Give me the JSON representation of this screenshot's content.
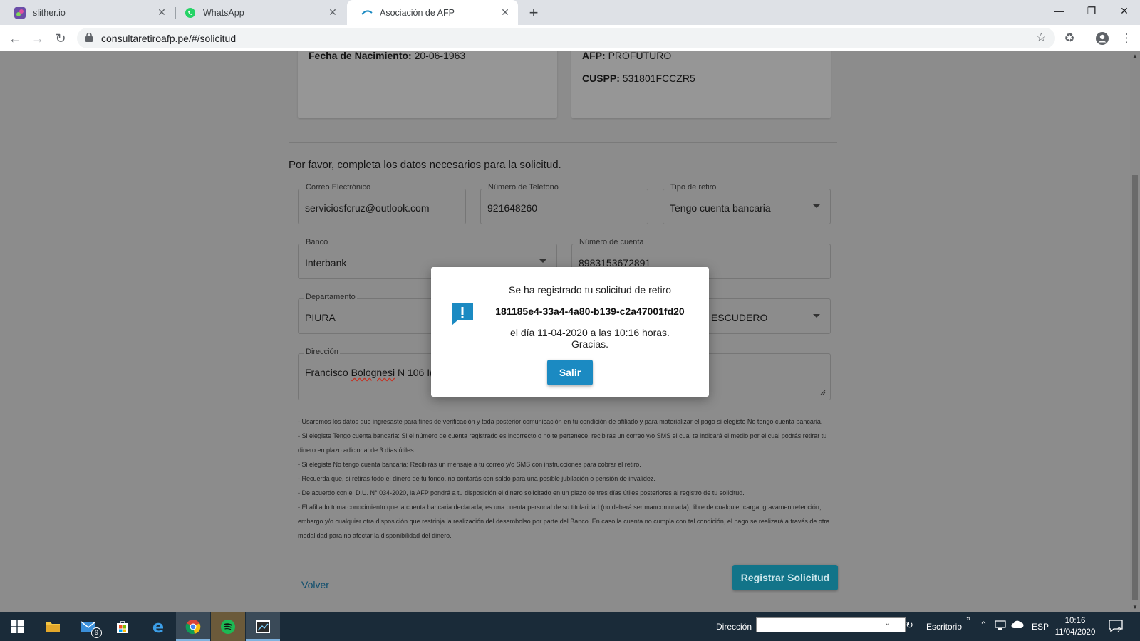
{
  "browser": {
    "tabs": [
      {
        "title": "slither.io",
        "close": "✕"
      },
      {
        "title": "WhatsApp",
        "close": "✕"
      },
      {
        "title": "Asociación de AFP",
        "close": "✕",
        "active": true
      }
    ],
    "new_tab": "+",
    "window_controls": {
      "minimize": "—",
      "restore": "❐",
      "close": "✕"
    },
    "url": "consultaretiroafp.pe/#/solicitud"
  },
  "page": {
    "personal": {
      "fecha_label": "Fecha de Nacimiento:",
      "fecha_value": "20-06-1963",
      "afp_label": "AFP:",
      "afp_value": "PROFUTURO",
      "cuspp_label": "CUSPP:",
      "cuspp_value": "531801FCCZR5"
    },
    "prompt": "Por favor, completa los datos necesarios para la solicitud.",
    "fields": {
      "email": {
        "label": "Correo Electrónico",
        "value": "serviciosfcruz@outlook.com"
      },
      "phone": {
        "label": "Número de Teléfono",
        "value": "921648260"
      },
      "withdrawal_type": {
        "label": "Tipo de retiro",
        "value": "Tengo cuenta bancaria"
      },
      "bank": {
        "label": "Banco",
        "value": "Interbank"
      },
      "account": {
        "label": "Número de cuenta",
        "value": "8983153672891"
      },
      "department": {
        "label": "Departamento",
        "value": "PIURA"
      },
      "district": {
        "value": "ESCUDERO"
      },
      "address": {
        "label": "Dirección",
        "value_a": "Francisco ",
        "value_b": "Bolognesi",
        "value_c": " N 106 I("
      }
    },
    "notes": [
      "- Usaremos los datos que ingresaste para fines de verificación y toda posterior comunicación en tu condición de afiliado y para materializar el pago si elegiste No tengo cuenta bancaria.",
      "- Si elegiste Tengo cuenta bancaria: Si el número de cuenta registrado es incorrecto o no te pertenece, recibirás un correo y/o SMS el cual te indicará el medio por el cual podrás retirar tu dinero en plazo adicional de 3 días útiles.",
      "- Si elegiste No tengo cuenta bancaria: Recibirás un mensaje a tu correo y/o SMS con instrucciones para cobrar el retiro.",
      "- Recuerda que, si retiras todo el dinero de tu fondo, no contarás con saldo para una posible jubilación o pensión de invalidez.",
      "- De acuerdo con el D.U. N° 034-2020, la AFP pondrá a tu disposición el dinero solicitado en un plazo de tres días útiles posteriores al registro de tu solicitud.",
      "- El afiliado toma conocimiento que la cuenta bancaria declarada, es una cuenta personal de su titularidad (no deberá ser mancomunada), libre de cualquier carga, gravamen retención, embargo y/o cualquier otra disposición que restrinja la realización del desembolso por parte del Banco. En caso la cuenta no cumpla con tal condición, el pago se realizará a través de otra modalidad para no afectar la disponibilidad del dinero."
    ],
    "back_label": "Volver",
    "submit_label": "Registrar Solicitud"
  },
  "modal": {
    "line1": "Se ha registrado tu solicitud de retiro",
    "request_id": "181185e4-33a4-4a80-b139-c2a47001fd20",
    "line3": "el día 11-04-2020 a las 10:16 horas. Gracias.",
    "exit_label": "Salir",
    "accent": "#1b8ac2"
  },
  "taskbar": {
    "mail_badge": "9",
    "address_label": "Dirección",
    "desktop_label": "Escritorio",
    "chevrons": "»",
    "language": "ESP",
    "time": "10:16",
    "date": "11/04/2020",
    "notifications": "2"
  }
}
